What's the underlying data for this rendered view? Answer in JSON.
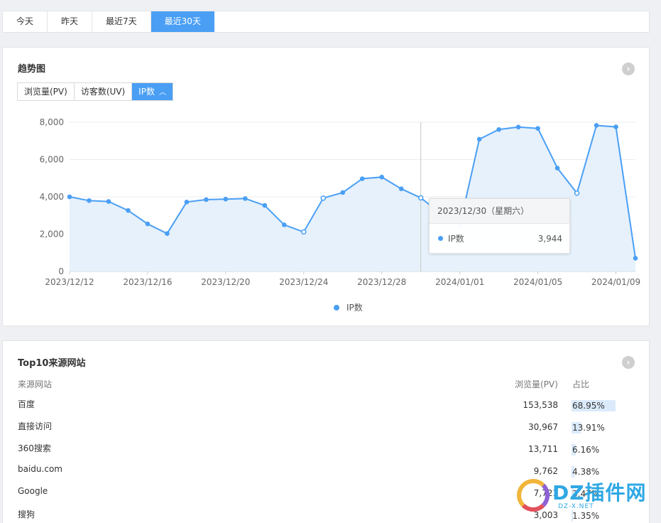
{
  "period_tabs": [
    {
      "label": "今天",
      "active": false
    },
    {
      "label": "昨天",
      "active": false
    },
    {
      "label": "最近7天",
      "active": false
    },
    {
      "label": "最近30天",
      "active": true
    }
  ],
  "trend": {
    "title": "趋势图",
    "more_icon": "chevron-right-circle-icon",
    "metric_tabs": [
      {
        "label": "浏览量(PV)",
        "active": false
      },
      {
        "label": "访客数(UV)",
        "active": false
      },
      {
        "label": "IP数",
        "active": true,
        "icon": "chevron-up-icon"
      }
    ],
    "tooltip": {
      "date": "2023/12/30（星期六）",
      "series": "IP数",
      "value": "3,944"
    },
    "legend": "IP数"
  },
  "chart_data": {
    "type": "area",
    "series": [
      {
        "name": "IP数",
        "values": [
          4000,
          3800,
          3750,
          3270,
          2550,
          2030,
          3720,
          3850,
          3880,
          3910,
          3540,
          2500,
          2120,
          3930,
          4230,
          4970,
          5060,
          4430,
          3944,
          3120,
          2480,
          7090,
          7610,
          7740,
          7670,
          5540,
          4200,
          7830,
          7750,
          710
        ]
      }
    ],
    "x": [
      "2023/12/12",
      "2023/12/13",
      "2023/12/14",
      "2023/12/15",
      "2023/12/16",
      "2023/12/17",
      "2023/12/18",
      "2023/12/19",
      "2023/12/20",
      "2023/12/21",
      "2023/12/22",
      "2023/12/23",
      "2023/12/24",
      "2023/12/25",
      "2023/12/26",
      "2023/12/27",
      "2023/12/28",
      "2023/12/29",
      "2023/12/30",
      "2023/12/31",
      "2024/01/01",
      "2024/01/02",
      "2024/01/03",
      "2024/01/04",
      "2024/01/05",
      "2024/01/06",
      "2024/01/07",
      "2024/01/08",
      "2024/01/09",
      "2024/01/10"
    ],
    "x_tick_labels": [
      "2023/12/12",
      "2023/12/16",
      "2023/12/20",
      "2023/12/24",
      "2023/12/28",
      "2024/01/01",
      "2024/01/05",
      "2024/01/09"
    ],
    "y_tick_labels": [
      "0",
      "2,000",
      "4,000",
      "6,000",
      "8,000"
    ],
    "ylim": [
      0,
      8000
    ],
    "grid": true,
    "legend_position": "bottom",
    "highlight": "2023/12/30",
    "colors": {
      "line": "#4a9ff5",
      "fill": "#e3effb"
    }
  },
  "top10": {
    "title": "Top10来源网站",
    "more_icon": "chevron-right-circle-icon",
    "headers": {
      "source": "来源网站",
      "pv": "浏览量(PV)",
      "ratio": "占比"
    },
    "rows": [
      {
        "name": "百度",
        "pv": "153,538",
        "ratio": "68.95%",
        "fraction": 0.6895
      },
      {
        "name": "直接访问",
        "pv": "30,967",
        "ratio": "13.91%",
        "fraction": 0.1391
      },
      {
        "name": "360搜索",
        "pv": "13,711",
        "ratio": "6.16%",
        "fraction": 0.0616
      },
      {
        "name": "baidu.com",
        "pv": "9,762",
        "ratio": "4.38%",
        "fraction": 0.0438
      },
      {
        "name": "Google",
        "pv": "7,721",
        "ratio": "3.47%",
        "fraction": 0.0347
      },
      {
        "name": "搜狗",
        "pv": "3,003",
        "ratio": "1.35%",
        "fraction": 0.0135
      }
    ]
  },
  "watermark": {
    "text": "DZ插件网",
    "sub": "DZ-X.NET"
  }
}
